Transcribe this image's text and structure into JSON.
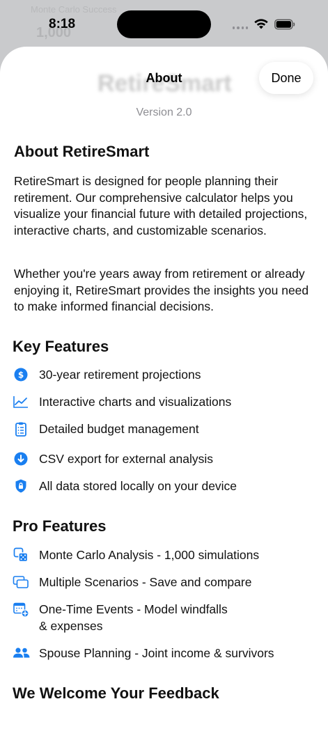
{
  "background": {
    "ghost_line1": "Monte Carlo Success",
    "ghost_line2": "1,000"
  },
  "status_bar": {
    "time": "8:18"
  },
  "sheet": {
    "ghost_title": "RetireSmart",
    "nav_title": "About",
    "done_label": "Done",
    "version": "Version 2.0",
    "about_heading": "About RetireSmart",
    "about_paragraph_1": "RetireSmart is designed for people planning their retirement. Our comprehensive calculator helps you visualize your financial future with detailed projections, interactive charts, and customizable scenarios.",
    "about_paragraph_2": "Whether you're years away from retirement or already enjoying it, RetireSmart provides the insights you need to make informed financial decisions.",
    "key_features_heading": "Key Features",
    "key_features": [
      {
        "icon": "dollar-circle-icon",
        "label": "30-year retirement projections"
      },
      {
        "icon": "line-chart-icon",
        "label": "Interactive charts and visualizations"
      },
      {
        "icon": "clipboard-icon",
        "label": "Detailed budget management"
      },
      {
        "icon": "download-circle-icon",
        "label": "CSV export for external analysis"
      },
      {
        "icon": "lock-shield-icon",
        "label": "All data stored locally on your device"
      }
    ],
    "pro_features_heading": "Pro Features",
    "pro_features": [
      {
        "icon": "dice-icon",
        "label": "Monte Carlo Analysis - 1,000 simulations"
      },
      {
        "icon": "stacked-windows-icon",
        "label": "Multiple Scenarios - Save and compare"
      },
      {
        "icon": "calendar-plus-icon",
        "label": "One-Time Events - Model windfalls",
        "label_line2": "& expenses"
      },
      {
        "icon": "people-icon",
        "label": "Spouse Planning - Joint income & survivors"
      }
    ],
    "feedback_heading": "We Welcome Your Feedback"
  },
  "colors": {
    "accent": "#1a7ff0",
    "secondary_text": "#8e8e93"
  }
}
